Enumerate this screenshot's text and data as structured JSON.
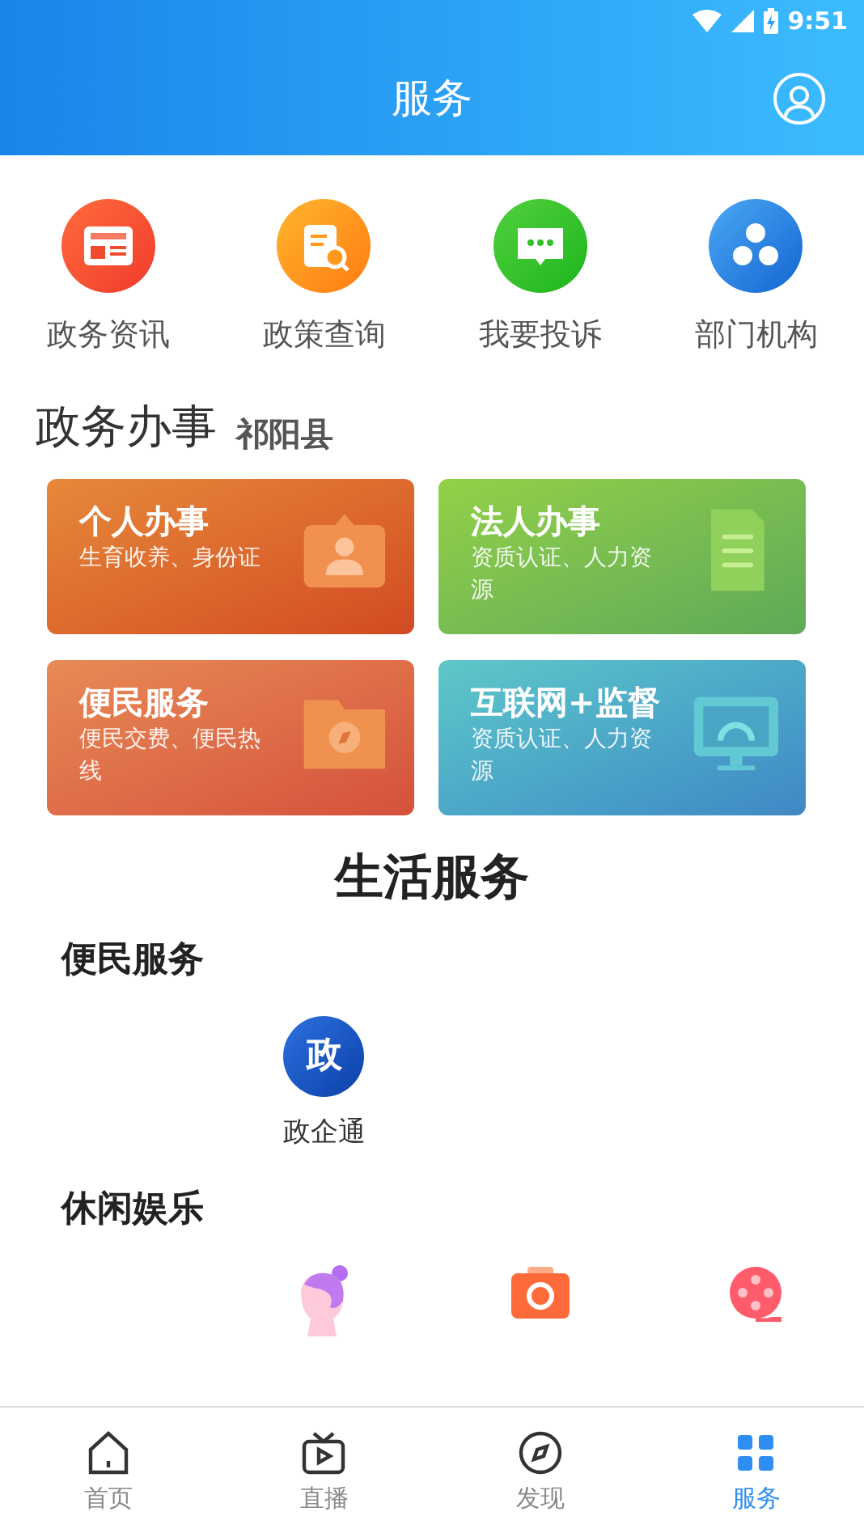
{
  "status_bar": {
    "time": "9:51"
  },
  "header": {
    "title": "服务"
  },
  "quick_links": [
    {
      "label": "政务资讯",
      "kind": "news"
    },
    {
      "label": "政策查询",
      "kind": "policy"
    },
    {
      "label": "我要投诉",
      "kind": "chat"
    },
    {
      "label": "部门机构",
      "kind": "org"
    }
  ],
  "affairs": {
    "title": "政务办事",
    "region": "祁阳县",
    "cards": [
      {
        "title": "个人办事",
        "subtitle": "生育收养、身份证",
        "kind": "personal"
      },
      {
        "title": "法人办事",
        "subtitle": "资质认证、人力资源",
        "kind": "legal"
      },
      {
        "title": "便民服务",
        "subtitle": "便民交费、便民热线",
        "kind": "convenience"
      },
      {
        "title": "互联网+监督",
        "subtitle": "资质认证、人力资源",
        "kind": "internet"
      }
    ]
  },
  "life": {
    "title": "生活服务",
    "sections": [
      {
        "title": "便民服务",
        "items": [
          {
            "kind": "gov",
            "icon_text": "政",
            "label": "政企通"
          }
        ]
      },
      {
        "title": "休闲娱乐",
        "items": [
          {
            "kind": "beauty"
          },
          {
            "kind": "camera"
          },
          {
            "kind": "film"
          }
        ]
      }
    ]
  },
  "bottom_nav": [
    {
      "label": "首页",
      "kind": "home",
      "selected": false
    },
    {
      "label": "直播",
      "kind": "tv",
      "selected": false
    },
    {
      "label": "发现",
      "kind": "discover",
      "selected": false
    },
    {
      "label": "服务",
      "kind": "service",
      "selected": true
    }
  ]
}
